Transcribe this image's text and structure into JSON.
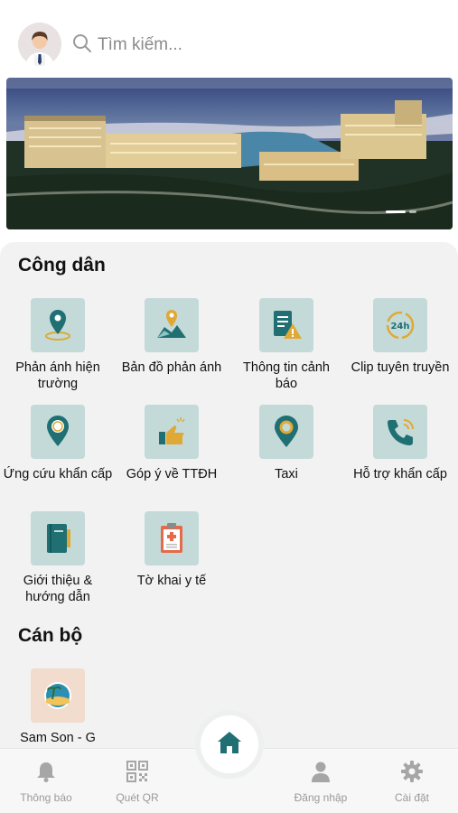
{
  "header": {
    "search_placeholder": "Tìm kiếm..."
  },
  "sections": {
    "citizen": {
      "title": "Công dân",
      "items": [
        {
          "label": "Phản ánh hiện trường",
          "icon": "map-pin-icon"
        },
        {
          "label": "Bản đồ phản ánh",
          "icon": "map-icon"
        },
        {
          "label": "Thông tin cảnh báo",
          "icon": "warning-document-icon"
        },
        {
          "label": "Clip tuyên truyền",
          "icon": "24h-clock-icon"
        },
        {
          "label": "Ứng cứu khẩn cấp",
          "icon": "sos-pin-icon"
        },
        {
          "label": "Góp ý về TTĐH",
          "icon": "feedback-hand-icon"
        },
        {
          "label": "Taxi",
          "icon": "taxi-pin-icon"
        },
        {
          "label": "Hỗ trợ khẩn cấp",
          "icon": "phone-call-icon"
        },
        {
          "label": "Giới thiệu & hướng dẫn",
          "icon": "book-icon"
        },
        {
          "label": "Tờ khai y tế",
          "icon": "medical-clipboard-icon"
        }
      ]
    },
    "staff": {
      "title": "Cán bộ",
      "items": [
        {
          "label": "Sam Son - G",
          "icon": "sam-son-logo-icon"
        }
      ]
    }
  },
  "tabbar": {
    "notifications": "Thông báo",
    "scan_qr": "Quét QR",
    "login": "Đăng nhập",
    "settings": "Cài đặt"
  },
  "colors": {
    "accent": "#1f6f73",
    "tile_bg": "#c3dad9",
    "panel_bg": "#f2f2f2"
  }
}
